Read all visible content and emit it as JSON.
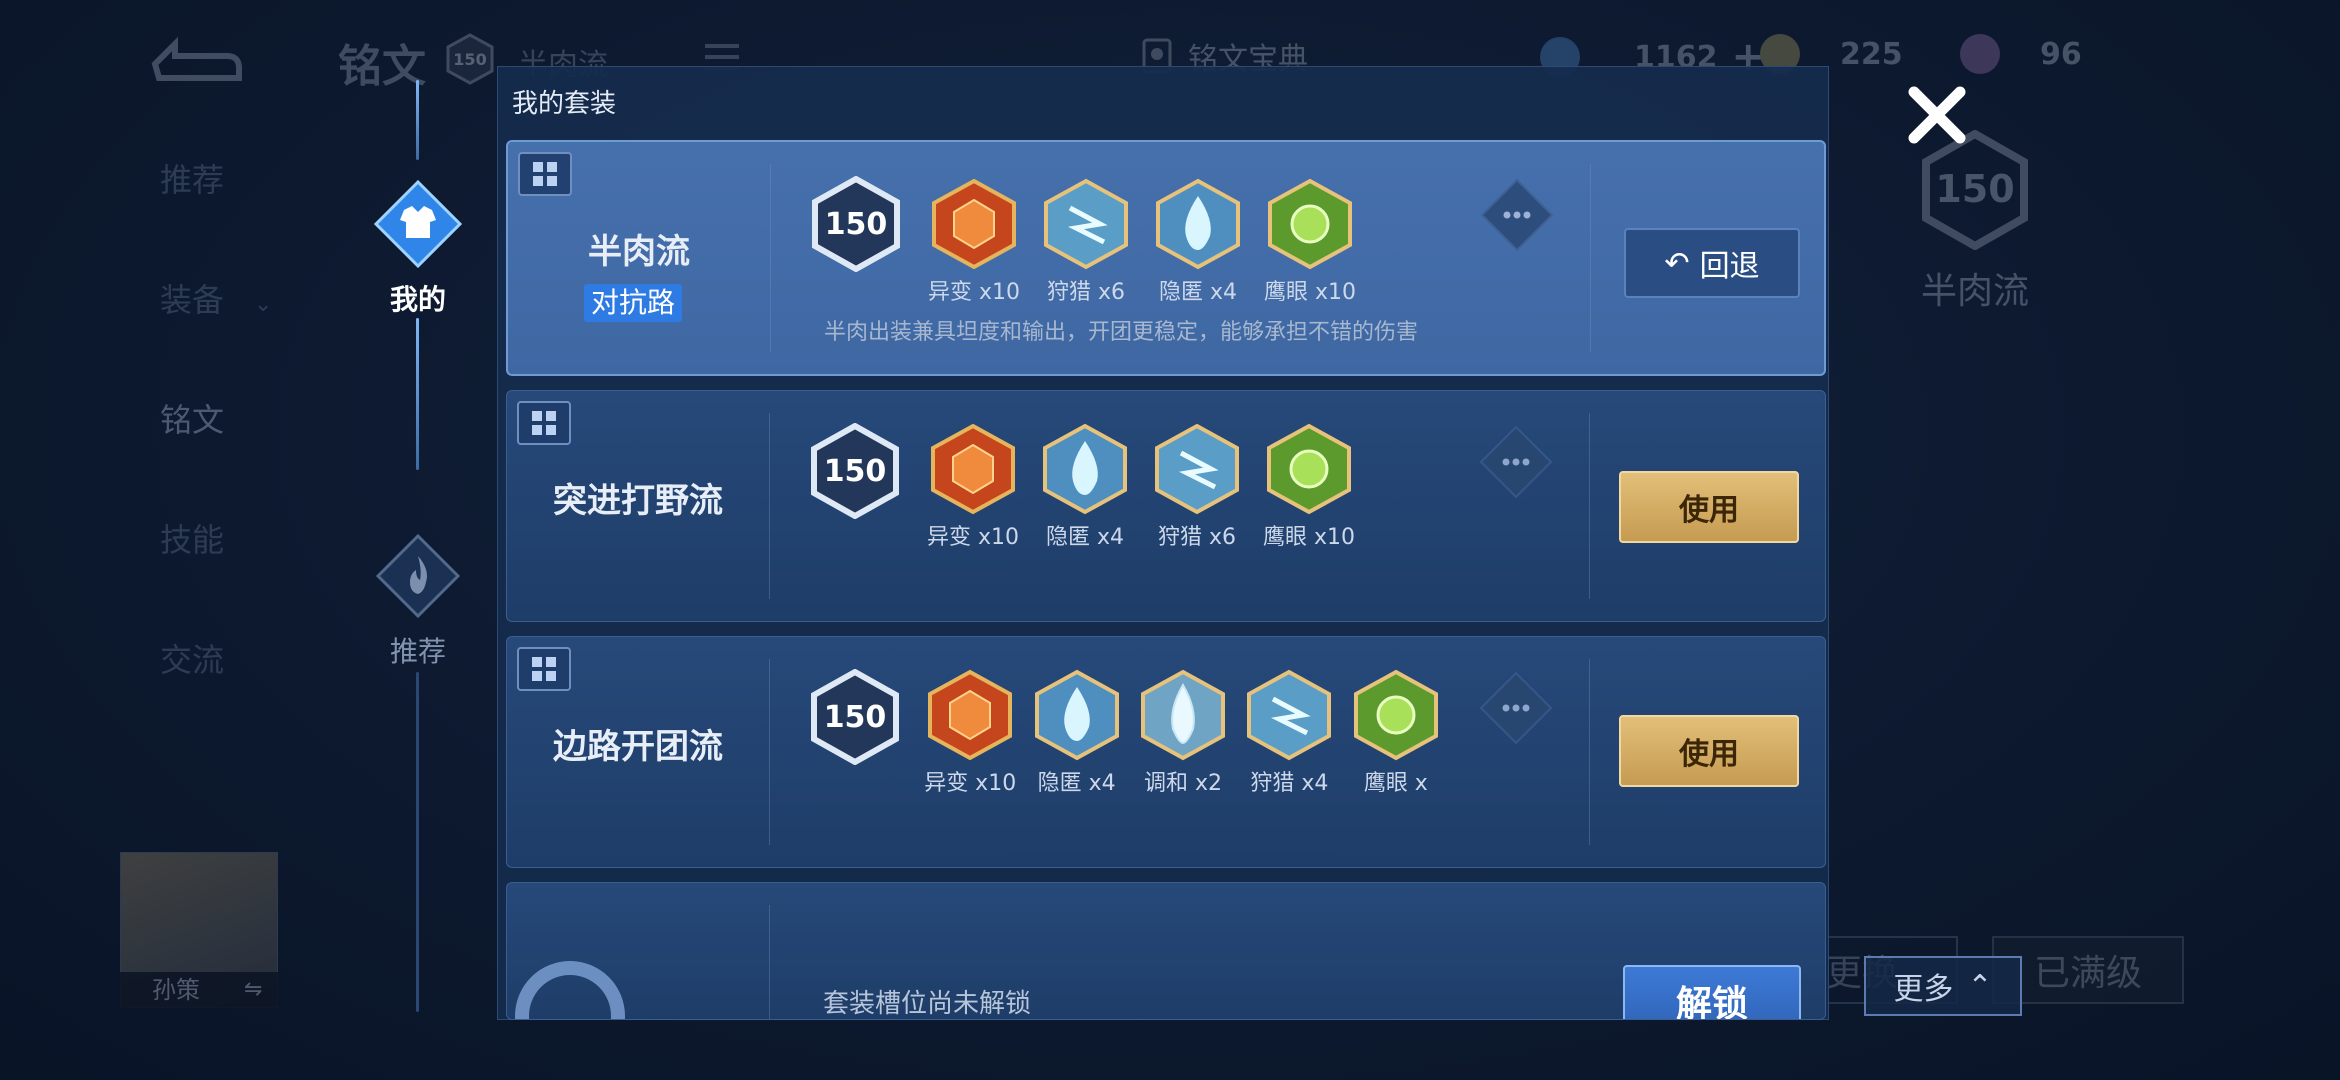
{
  "background": {
    "page_title": "铭文",
    "level_badge": "150",
    "set_name": "半肉流",
    "codex_label": "铭文宝典",
    "resources": [
      {
        "icon": "gem-icon",
        "value": "1162"
      },
      {
        "icon": "coin-icon",
        "value": "225"
      },
      {
        "icon": "crystal-icon",
        "value": "96"
      }
    ],
    "nav": [
      "推荐",
      "装备",
      "铭文",
      "技能",
      "交流"
    ],
    "hero_name": "孙策",
    "right_level": "150",
    "right_set_name": "半肉流",
    "faint_button": "更换",
    "maxed_label": "已满级",
    "more_label": "更多"
  },
  "tabs": {
    "mine": "我的",
    "recommended": "推荐"
  },
  "modal": {
    "header": "我的套装",
    "sets": [
      {
        "name": "半肉流",
        "tag": "对抗路",
        "level": "150",
        "runes": [
          {
            "label": "异变 x10",
            "color": "red"
          },
          {
            "label": "狩猎 x6",
            "color": "blue"
          },
          {
            "label": "隐匿 x4",
            "color": "blue"
          },
          {
            "label": "鹰眼 x10",
            "color": "green"
          }
        ],
        "description": "半肉出装兼具坦度和输出，开团更稳定，能够承担不错的伤害",
        "action": "回退"
      },
      {
        "name": "突进打野流",
        "level": "150",
        "runes": [
          {
            "label": "异变 x10",
            "color": "red"
          },
          {
            "label": "隐匿 x4",
            "color": "blue"
          },
          {
            "label": "狩猎 x6",
            "color": "blue"
          },
          {
            "label": "鹰眼 x10",
            "color": "green"
          }
        ],
        "action": "使用"
      },
      {
        "name": "边路开团流",
        "level": "150",
        "runes": [
          {
            "label": "异变 x10",
            "color": "red"
          },
          {
            "label": "隐匿 x4",
            "color": "blue"
          },
          {
            "label": "调和 x2",
            "color": "blue"
          },
          {
            "label": "狩猎 x4",
            "color": "blue"
          },
          {
            "label": "鹰眼 x",
            "color": "green"
          }
        ],
        "action": "使用"
      },
      {
        "locked_text": "套装槽位尚未解锁",
        "action": "解锁"
      }
    ]
  },
  "colors": {
    "gold_button": "#d4ad66",
    "blue_tag": "#2f7be4",
    "active_card": "#4670ac",
    "panel": "#162c4e"
  }
}
